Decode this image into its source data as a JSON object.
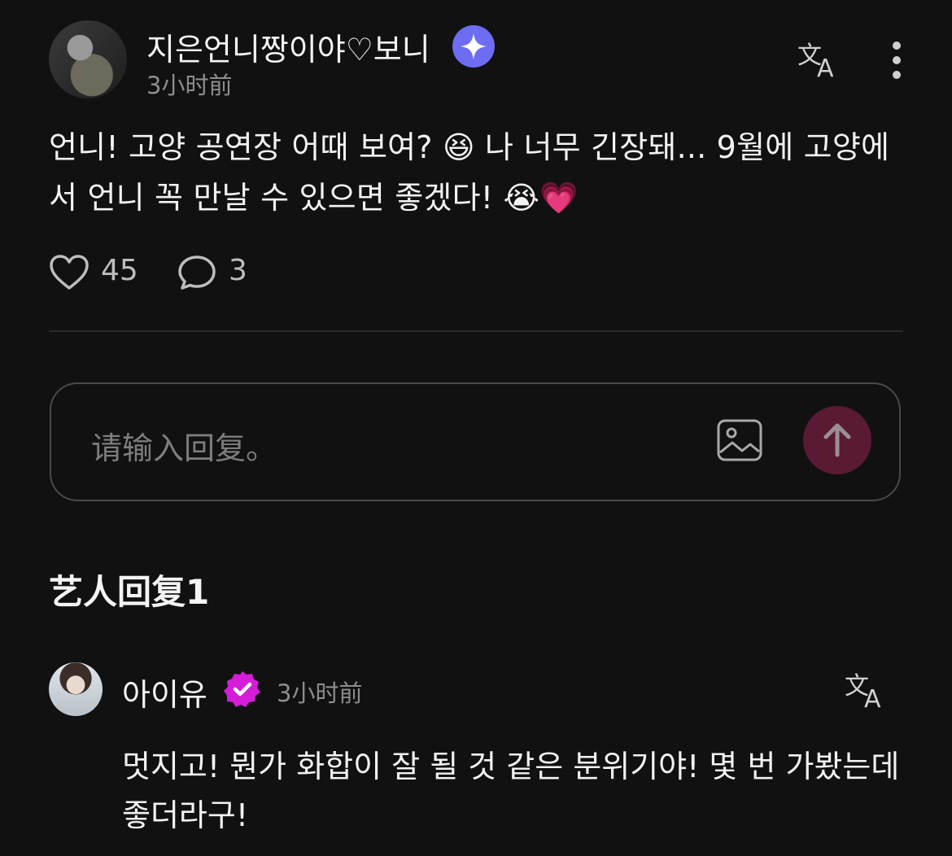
{
  "post": {
    "author": "지은언니짱이야♡보니",
    "time": "3小时前",
    "text": "언니! 고양 공연장 어때 보여? 😆 나 너무 긴장돼... 9월에 고양에서 언니 꼭 만날 수 있으면 좋겠다! 😭💗",
    "likes": "45",
    "comments": "3"
  },
  "input": {
    "placeholder": "请输入回复。"
  },
  "section": {
    "title": "艺人回复1"
  },
  "reply": {
    "author": "아이유",
    "time": "3小时前",
    "text": "멋지고! 뭔가 화합이 잘 될 것 같은 분위기야! 몇 번 가봤는데 좋더라구!"
  },
  "colors": {
    "background": "#121112",
    "accent_send": "#5a1a33",
    "sparkle_badge": "#6d6cf2",
    "verified_badge": "#d51dd8"
  },
  "icons": [
    "sparkle-badge-icon",
    "translate-icon",
    "more-vertical-icon",
    "heart-icon",
    "comment-icon",
    "image-icon",
    "arrow-up-icon",
    "verified-badge-icon"
  ]
}
